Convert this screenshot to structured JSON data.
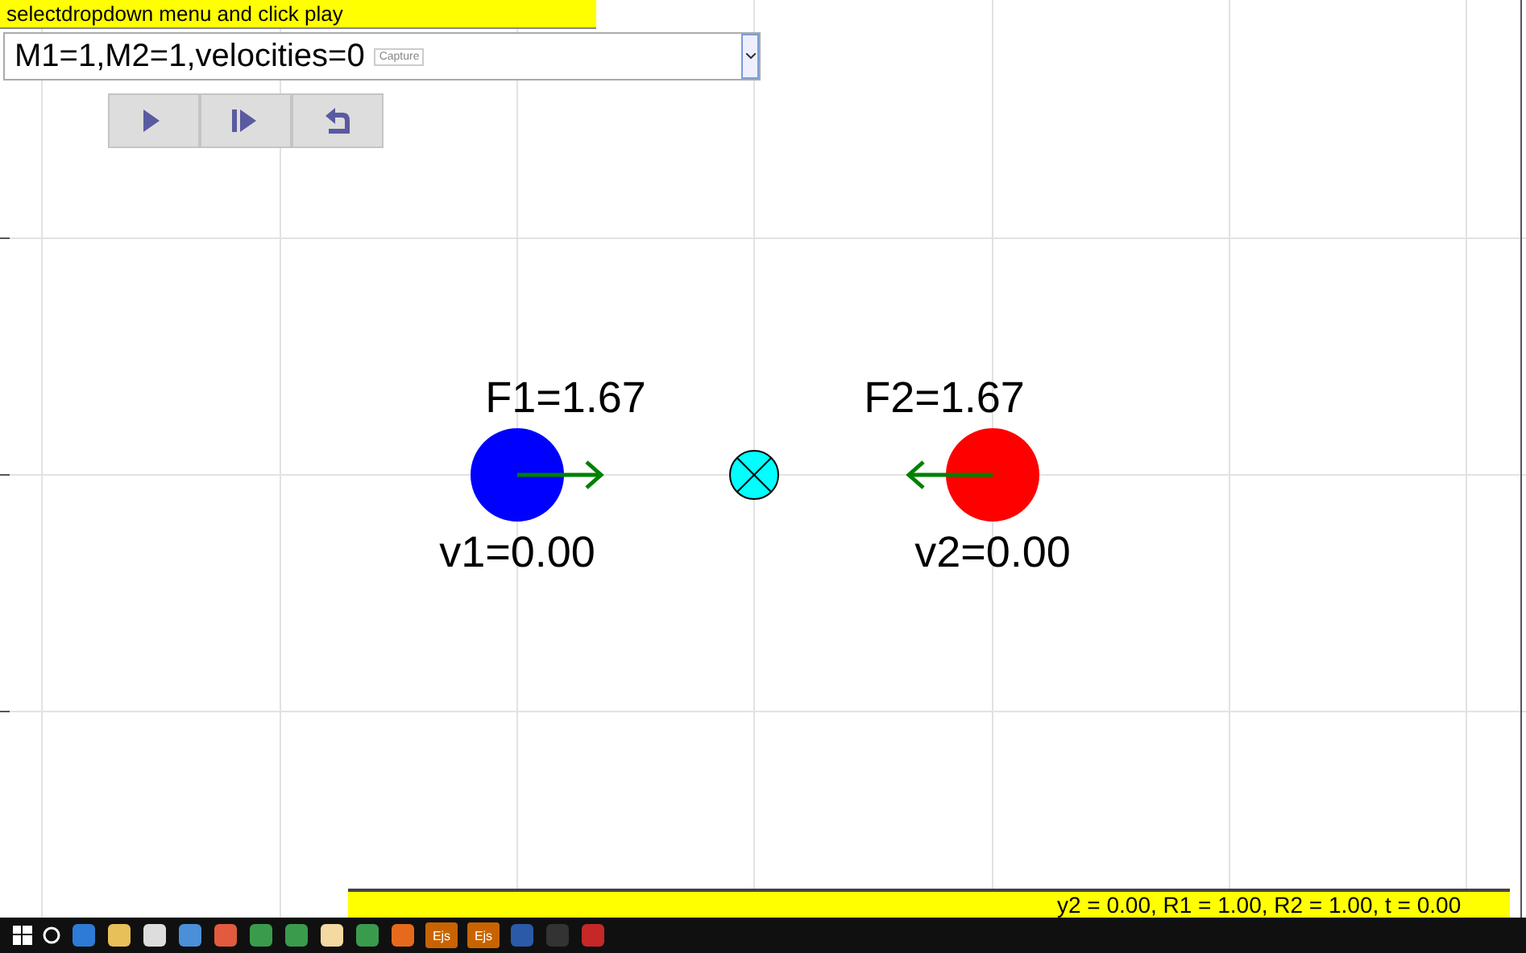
{
  "instruction_bar": {
    "text": "selectdropdown menu and click play"
  },
  "dropdown": {
    "value": "M1=1,M2=1,velocities=0",
    "capture_button": "Capture"
  },
  "controls": [
    {
      "kind": "play"
    },
    {
      "kind": "step"
    },
    {
      "kind": "reset"
    }
  ],
  "bodies": [
    {
      "color": "#0000ff",
      "velocity_label": "v1=0.00",
      "force_label": "F1=1.67",
      "force_points_left": false
    },
    {
      "color": "#ff0000",
      "velocity_label": "v2=0.00",
      "force_label": "F2=1.67",
      "force_points_left": true
    }
  ],
  "status_bar": {
    "text": "y2 = 0.00, R1 = 1.00, R2 = 1.00, t = 0.00"
  },
  "taskbar": {
    "items": [
      {
        "kind": "start"
      },
      {
        "kind": "search"
      },
      {
        "kind": "browser"
      },
      {
        "kind": "folder"
      },
      {
        "kind": "store"
      },
      {
        "kind": "document"
      },
      {
        "kind": "pdf"
      },
      {
        "kind": "chrome"
      },
      {
        "kind": "chrome"
      },
      {
        "kind": "grid"
      },
      {
        "kind": "chrome"
      },
      {
        "kind": "firefox"
      },
      {
        "kind": "app",
        "label": "Ejs"
      },
      {
        "kind": "app",
        "label": "Ejs"
      },
      {
        "kind": "word"
      },
      {
        "kind": "terminal"
      },
      {
        "kind": "ftp"
      }
    ]
  }
}
